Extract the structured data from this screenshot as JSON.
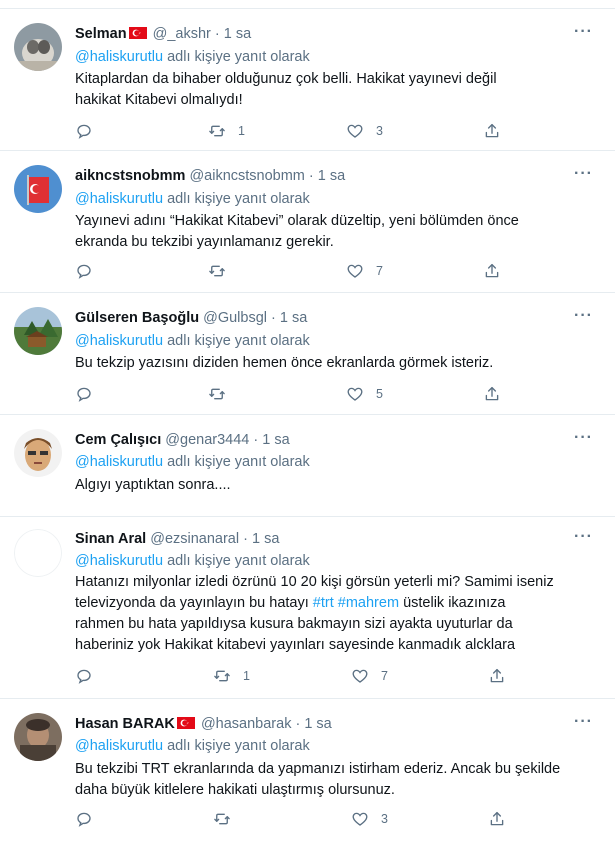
{
  "reply_prefix": "adlı kişiye yanıt olarak",
  "tweets": [
    {
      "name": "Selman",
      "handle": "@_akshr",
      "time": "· 1 sa",
      "mention": "@haliskurutlu",
      "text": "Kitaplardan da bihaber olduğunuz çok belli. Hakikat yayınevi değil hakikat Kitabevi olmalıydı!",
      "retweets": "1",
      "likes": "3"
    },
    {
      "name": "aikncstsnobmm",
      "handle": "@aikncstsnobmm",
      "time": "· 1 sa",
      "mention": "@haliskurutlu",
      "text": "Yayınevi adını “Hakikat Kitabevi” olarak düzeltip, yeni bölümden önce ekranda bu tekzibi yayınlamanız gerekir.",
      "retweets": "",
      "likes": "7"
    },
    {
      "name": "Gülseren Başoğlu",
      "handle": "@Gulbsgl",
      "time": "· 1 sa",
      "mention": "@haliskurutlu",
      "text": "Bu tekzip yazısını diziden hemen önce ekranlarda görmek isteriz.",
      "retweets": "",
      "likes": "5"
    },
    {
      "name": "Cem Çalışıcı",
      "handle": "@genar3444",
      "time": "· 1 sa",
      "mention": "@haliskurutlu",
      "text": "Algıyı yaptıktan sonra...."
    },
    {
      "name": "Sinan Aral",
      "handle": "@ezsinanaral",
      "time": "· 1 sa",
      "mention": "@haliskurutlu",
      "text_a": "Hatanızı milyonlar izledi özrünü 10 20 kişi görsün yeterli mi? Samimi iseniz televizyonda da yayınlayın bu hatayı",
      "hashtag1": "#trt",
      "hashtag2": "#mahrem",
      "text_b": "üstelik ikazınıza rahmen bu hata yapıldıysa kusura bakmayın sizi ayakta uyuturlar da haberiniz yok Hakikat kitabevi yayınları sayesinde kanmadık alcklara",
      "retweets": "1",
      "likes": "7"
    },
    {
      "name": "Hasan BARAK",
      "handle": "@hasanbarak",
      "time": "· 1 sa",
      "mention": "@haliskurutlu",
      "text": "Bu tekzibi TRT ekranlarında da yapmanızı istirham ederiz. Ancak bu şekilde daha büyük kitlelere hakikati ulaştırmış olursunuz.",
      "retweets": "",
      "likes": "3"
    }
  ],
  "colors": {
    "accent": "#1da1f2",
    "secondary_text": "#5b7083",
    "divider": "#e6ecf0",
    "flag_red": "#e30a17"
  },
  "icons": [
    "reply-icon",
    "retweet-icon",
    "like-icon",
    "share-icon",
    "more-icon",
    "turkish-flag-icon"
  ]
}
